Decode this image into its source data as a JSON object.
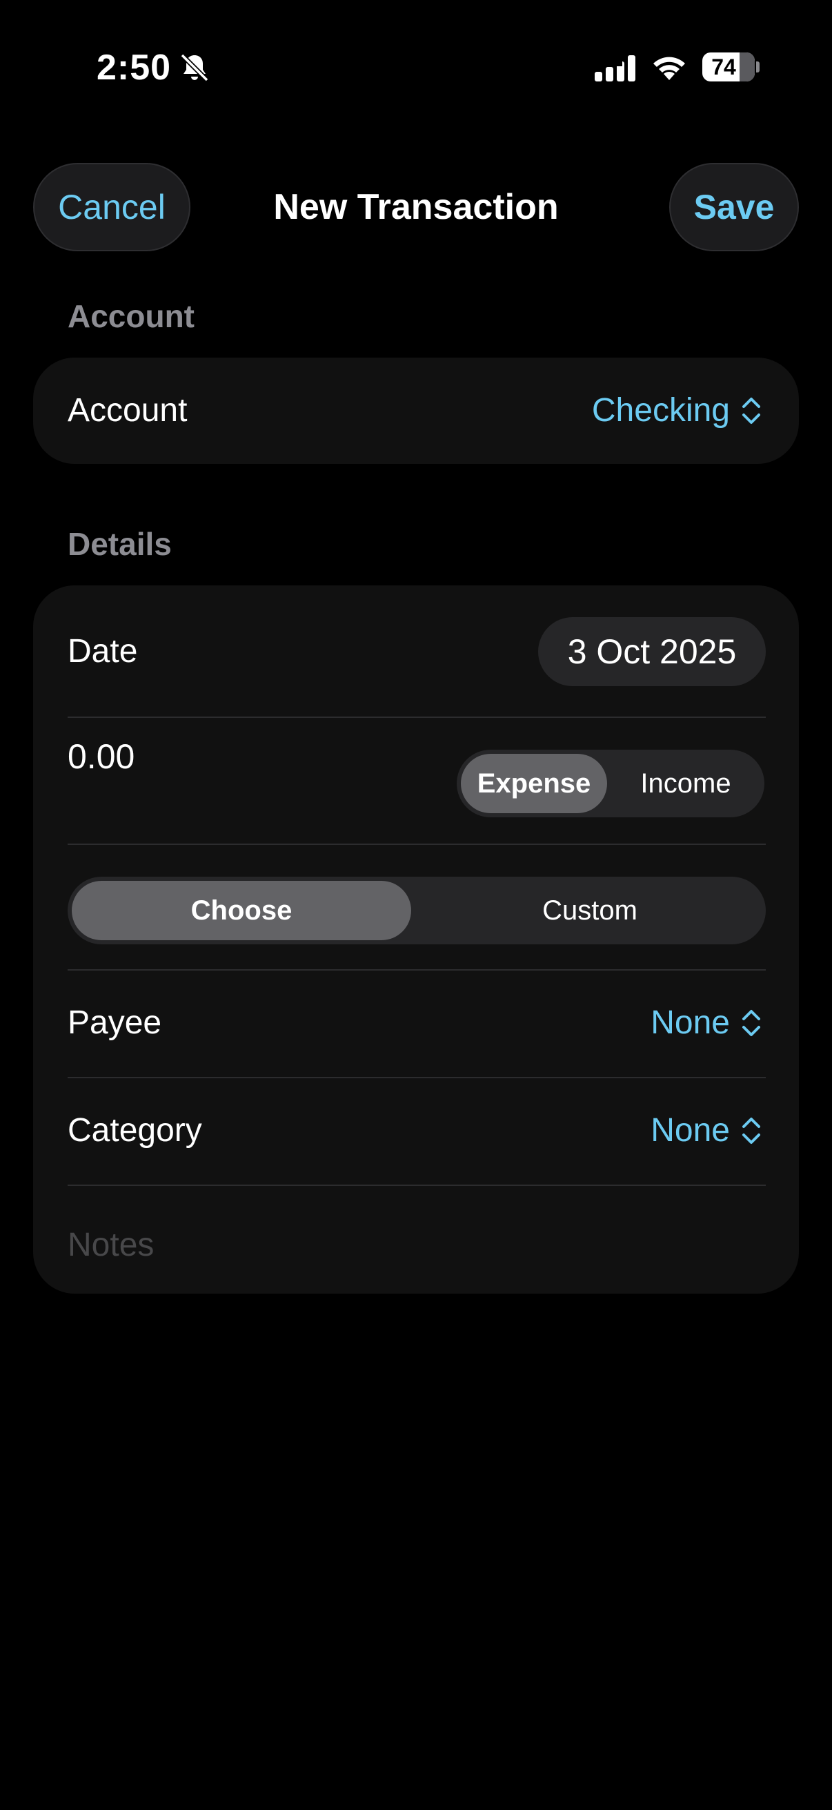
{
  "status_bar": {
    "time": "2:50",
    "battery": "74",
    "icons": [
      "bell-slash-icon",
      "cellular-signal-icon",
      "wifi-icon",
      "battery-icon"
    ]
  },
  "nav": {
    "cancel_label": "Cancel",
    "title": "New Transaction",
    "save_label": "Save"
  },
  "account_section": {
    "header": "Account",
    "row_label": "Account",
    "row_value": "Checking"
  },
  "details_section": {
    "header": "Details",
    "date_label": "Date",
    "date_value": "3 Oct 2025",
    "amount": "0.00",
    "type_options": [
      "Expense",
      "Income"
    ],
    "type_selected": "Expense",
    "payee_mode_options": [
      "Choose",
      "Custom"
    ],
    "payee_mode_selected": "Choose",
    "payee_label": "Payee",
    "payee_value": "None",
    "category_label": "Category",
    "category_value": "None",
    "notes_placeholder": "Notes"
  },
  "colors": {
    "accent": "#6ccbf2",
    "background": "#000000",
    "card": "#111111",
    "secondary_text": "#8d8d93"
  }
}
